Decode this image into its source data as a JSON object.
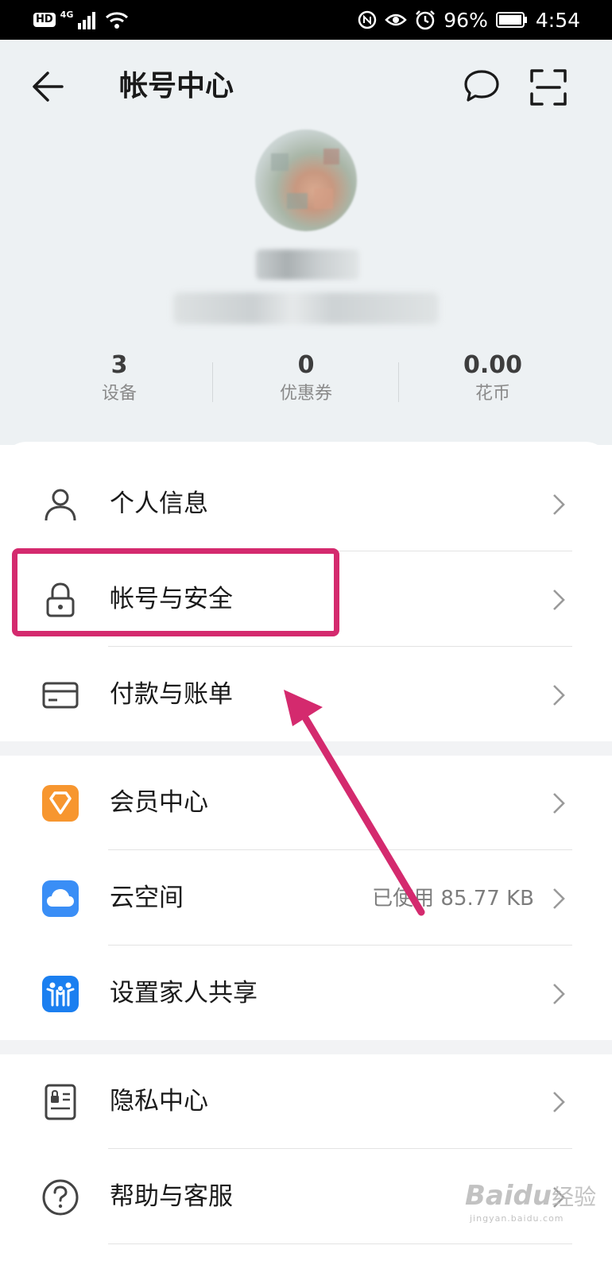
{
  "status_bar": {
    "hd": "HD",
    "network": "4G",
    "battery": "96%",
    "time": "4:54"
  },
  "header": {
    "title": "帐号中心",
    "back_icon": "back-arrow-icon",
    "message_icon": "chat-bubble-icon",
    "scan_icon": "scan-icon"
  },
  "stats": [
    {
      "value": "3",
      "label": "设备"
    },
    {
      "value": "0",
      "label": "优惠券"
    },
    {
      "value": "0.00",
      "label": "花币"
    }
  ],
  "menu": {
    "personal_info": "个人信息",
    "account_security": "帐号与安全",
    "payment_billing": "付款与账单",
    "member_center": "会员中心",
    "cloud_space": "云空间",
    "cloud_space_usage": "已使用 85.77 KB",
    "family_sharing": "设置家人共享",
    "privacy_center": "隐私中心",
    "help_service": "帮助与客服"
  },
  "colors": {
    "accent_highlight": "#d42a6e",
    "member_icon": "#f7962f",
    "cloud_icon": "#3a8ef6",
    "family_icon": "#1b7ff0"
  },
  "watermark": {
    "brand": "Bai",
    "brand_du": "du",
    "cn": "经验",
    "sub": "jingyan.baidu.com"
  }
}
